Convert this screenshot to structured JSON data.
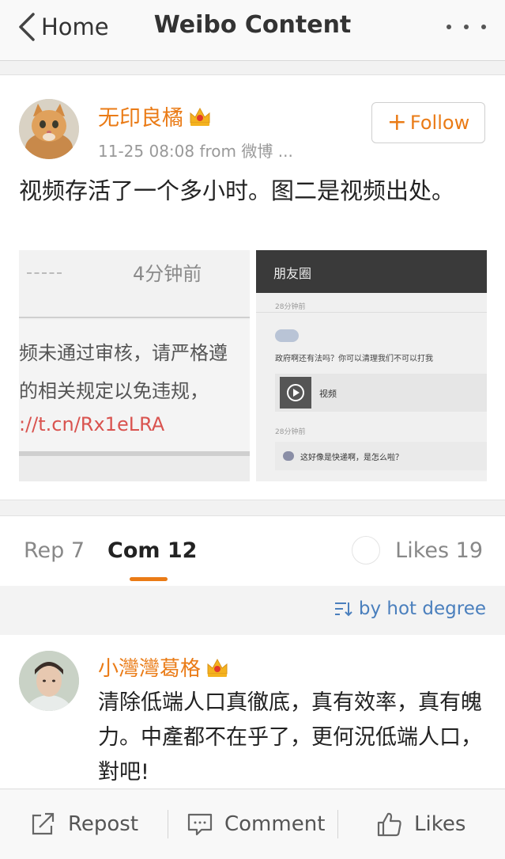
{
  "header": {
    "back_label": "Home",
    "title": "Weibo Content"
  },
  "post": {
    "username": "无印良橘",
    "meta": "11-25 08:08  from 微博 ...",
    "follow_label": "Follow",
    "text": "视频存活了一个多小时。图二是视频出处。",
    "image1": {
      "time_label": "4分钟前",
      "line1": "频未通过审核，请严格遵",
      "line2": "的相关规定以免违规，",
      "link": "://t.cn/Rx1eLRA"
    },
    "image2": {
      "title": "朋友圈",
      "time1": "28分钟前",
      "question": "政府啊还有法吗？你可以清理我们不可以打我",
      "video_label": "视频",
      "time2": "28分钟前",
      "reply": "这好像是快递啊，是怎么啦？"
    }
  },
  "tabs": {
    "repost": "Rep 7",
    "comments": "Com 12",
    "likes": "Likes 19"
  },
  "sort": {
    "label": "by hot degree"
  },
  "comment": {
    "username": "小灣灣葛格",
    "text": "清除低端人口真徹底，真有效率，真有魄力。中產都不在乎了，更何況低端人口，對吧!"
  },
  "bottom_bar": {
    "repost": "Repost",
    "comment": "Comment",
    "likes": "Likes"
  },
  "colors": {
    "accent": "#ea7b16",
    "link_blue": "#4a7fbd"
  }
}
